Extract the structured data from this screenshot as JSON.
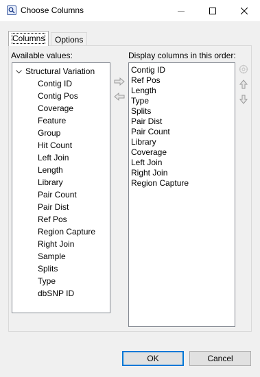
{
  "window": {
    "title": "Choose Columns",
    "icon": "magnifier-app-icon"
  },
  "tabs": [
    {
      "label": "Columns",
      "active": true
    },
    {
      "label": "Options",
      "active": false
    }
  ],
  "available": {
    "label": "Available values:",
    "root": "Structural Variation",
    "items": [
      "Contig ID",
      "Contig Pos",
      "Coverage",
      "Feature",
      "Group",
      "Hit Count",
      "Left Join",
      "Length",
      "Library",
      "Pair Count",
      "Pair Dist",
      "Ref Pos",
      "Region Capture",
      "Right Join",
      "Sample",
      "Splits",
      "Type",
      "dbSNP ID"
    ]
  },
  "display": {
    "label": "Display columns in this order:",
    "items": [
      "Contig ID",
      "Ref Pos",
      "Length",
      "Type",
      "Splits",
      "Pair Dist",
      "Pair Count",
      "Library",
      "Coverage",
      "Left Join",
      "Right Join",
      "Region Capture"
    ]
  },
  "buttons": {
    "ok": "OK",
    "cancel": "Cancel"
  }
}
